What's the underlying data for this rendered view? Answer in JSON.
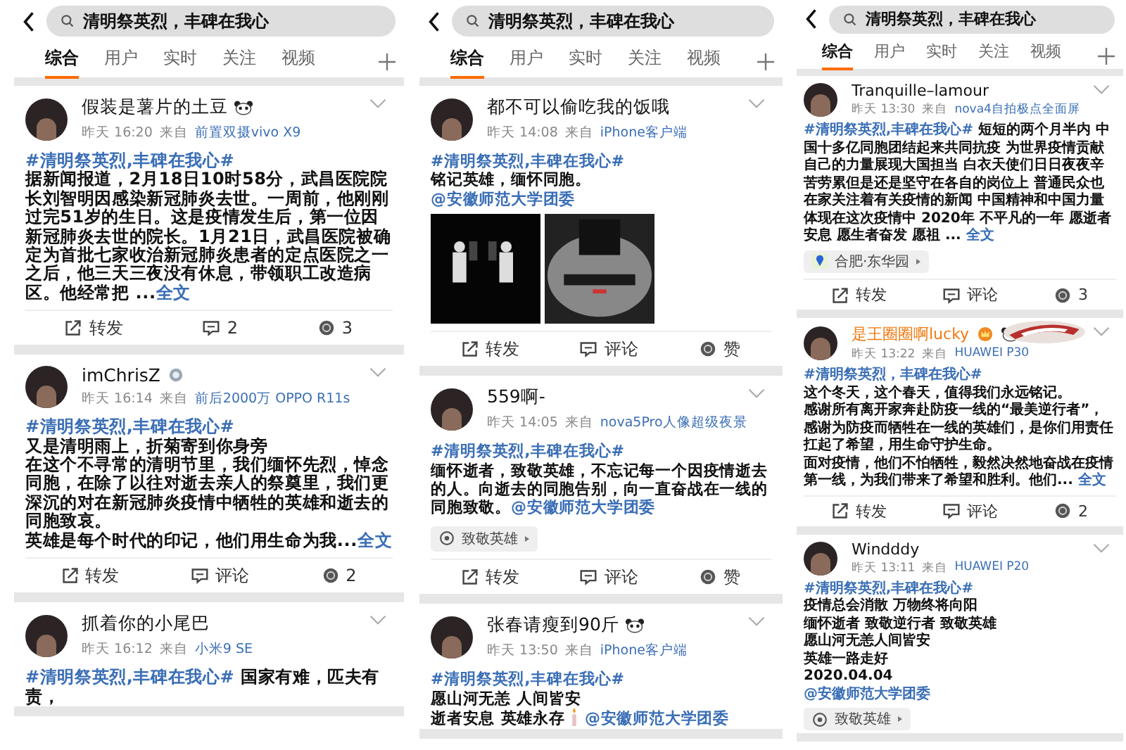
{
  "panels": [
    {
      "search": {
        "query": "清明祭英烈，丰碑在我心"
      },
      "tabs": [
        {
          "label": "综合",
          "selected": true
        },
        {
          "label": "用户",
          "selected": false
        },
        {
          "label": "实时",
          "selected": false
        },
        {
          "label": "关注",
          "selected": false
        },
        {
          "label": "视频",
          "selected": false
        }
      ],
      "posts": [
        {
          "user": "假装是薯片的土豆",
          "vip": false,
          "name_icons": [
            {
              "kind": "panda"
            }
          ],
          "time": "昨天 16:20",
          "from": "来自",
          "source": "前置双摄vivo X9",
          "body": [
            [
              {
                "kind": "tag",
                "text": "#清明祭英烈,丰碑在我心#"
              }
            ],
            [
              {
                "kind": "text",
                "text": "据新闻报道，2月18日10时58分，武昌医院院长刘智明因感染新冠肺炎去世。一周前，他刚刚过完51岁的生日。这是疫情发生后，第一位因新冠肺炎去世的院长。1月21日，武昌医院被确定为首批七家收治新冠肺炎患者的定点医院之一之后，他三天三夜没有休息，带领职工改造病区。他经常把 ..."
              },
              {
                "kind": "more",
                "text": "全文"
              }
            ]
          ],
          "actions": [
            {
              "kind": "repost",
              "label": "转发"
            },
            {
              "kind": "comment",
              "label": "2"
            },
            {
              "kind": "like",
              "label": "3"
            }
          ]
        },
        {
          "user": "imChrisZ",
          "vip": false,
          "name_icons": [
            {
              "kind": "medal"
            }
          ],
          "time": "昨天 16:14",
          "from": "来自",
          "source": "前后2000万 OPPO R11s",
          "body": [
            [
              {
                "kind": "tag",
                "text": "#清明祭英烈,丰碑在我心#"
              }
            ],
            [
              {
                "kind": "text",
                "text": "又是清明雨上，折菊寄到你身旁"
              }
            ],
            [
              {
                "kind": "text",
                "text": "在这个不寻常的清明节里，我们缅怀先烈，悼念同胞，在除了以往对逝去亲人的祭奠里，我们更深沉的对在新冠肺炎疫情中牺牲的英雄和逝去的同胞致哀。"
              }
            ],
            [
              {
                "kind": "text",
                "text": "英雄是每个时代的印记，他们用生命为我..."
              },
              {
                "kind": "more",
                "text": "全文"
              }
            ]
          ],
          "actions": [
            {
              "kind": "repost",
              "label": "转发"
            },
            {
              "kind": "comment",
              "label": "评论"
            },
            {
              "kind": "like",
              "label": "2"
            }
          ]
        },
        {
          "user": "抓着你的小尾巴",
          "vip": false,
          "time": "昨天 16:12",
          "from": "来自",
          "source": "小米9 SE",
          "body": [
            [
              {
                "kind": "tag",
                "text": "#清明祭英烈,丰碑在我心#"
              },
              {
                "kind": "text",
                "text": " 国家有难，匹夫有责，"
              }
            ]
          ]
        }
      ]
    },
    {
      "search": {
        "query": "清明祭英烈，丰碑在我心"
      },
      "tabs": [
        {
          "label": "综合",
          "selected": true
        },
        {
          "label": "用户",
          "selected": false
        },
        {
          "label": "实时",
          "selected": false
        },
        {
          "label": "关注",
          "selected": false
        },
        {
          "label": "视频",
          "selected": false
        }
      ],
      "posts": [
        {
          "user": "都不可以偷吃我的饭哦",
          "vip": false,
          "time": "昨天 14:08",
          "from": "来自",
          "source": "iPhone客户端",
          "body": [
            [
              {
                "kind": "tag",
                "text": "#清明祭英烈,丰碑在我心#"
              }
            ],
            [
              {
                "kind": "text",
                "text": "铭记英雄，缅怀同胞。"
              }
            ],
            [
              {
                "kind": "mention",
                "text": "@安徽师范大学团委"
              }
            ]
          ],
          "images": [
            {
              "kind": "picture"
            },
            {
              "kind": "picture"
            }
          ],
          "actions": [
            {
              "kind": "repost",
              "label": "转发"
            },
            {
              "kind": "comment",
              "label": "评论"
            },
            {
              "kind": "like",
              "label": "赞"
            }
          ]
        },
        {
          "user": "559啊-",
          "vip": false,
          "time": "昨天 14:05",
          "from": "来自",
          "source": "nova5Pro人像超级夜景",
          "body": [
            [
              {
                "kind": "tag",
                "text": "#清明祭英烈,丰碑在我心#"
              }
            ],
            [
              {
                "kind": "text",
                "text": "缅怀逝者，致敬英雄，不忘记每一个因疫情逝去的人。向逝去的同胞告别，向一直奋战在一线的同胞致敬。"
              },
              {
                "kind": "mention",
                "text": "@安徽师范大学团委"
              }
            ]
          ],
          "chip": {
            "kind": "topic",
            "text": "致敬英雄"
          },
          "actions": [
            {
              "kind": "repost",
              "label": "转发"
            },
            {
              "kind": "comment",
              "label": "评论"
            },
            {
              "kind": "like",
              "label": "赞"
            }
          ]
        },
        {
          "user": "张春请瘦到90斤",
          "vip": false,
          "name_icons": [
            {
              "kind": "panda"
            }
          ],
          "time": "昨天 13:50",
          "from": "来自",
          "source": "iPhone客户端",
          "body": [
            [
              {
                "kind": "tag",
                "text": "#清明祭英烈,丰碑在我心#"
              }
            ],
            [
              {
                "kind": "text",
                "text": "愿山河无恙  人间皆安"
              }
            ],
            [
              {
                "kind": "text",
                "text": "逝者安息   英雄永存"
              },
              {
                "kind": "candle"
              },
              {
                "kind": "mention",
                "text": "@安徽师范大学团委"
              }
            ]
          ]
        }
      ]
    },
    {
      "search": {
        "query": "清明祭英烈，丰碑在我心"
      },
      "tabs": [
        {
          "label": "综合",
          "selected": true
        },
        {
          "label": "用户",
          "selected": false
        },
        {
          "label": "实时",
          "selected": false
        },
        {
          "label": "关注",
          "selected": false
        },
        {
          "label": "视频",
          "selected": false
        }
      ],
      "posts": [
        {
          "user": "Tranquille–lamour",
          "vip": false,
          "time": "昨天 13:30",
          "from": "来自",
          "source": "nova4自拍极点全面屏",
          "body": [
            [
              {
                "kind": "tag",
                "text": "#清明祭英烈,丰碑在我心#"
              },
              {
                "kind": "text",
                "text": " 短短的两个月半内 中国十多亿同胞团结起来共同抗疫 为世界疫情贡献自己的力量展现大国担当 白衣天使们日日夜夜辛苦劳累但是还是坚守在各自的岗位上 普通民众也在家关注着有关疫情的新闻 中国精神和中国力量体现在这次疫情中 2020年 不平凡的一年 愿逝者安息 愿生者奋发 愿祖 ... "
              },
              {
                "kind": "more",
                "text": "全文"
              }
            ]
          ],
          "chip": {
            "kind": "location",
            "text": "合肥·东华园"
          },
          "actions": [
            {
              "kind": "repost",
              "label": "转发"
            },
            {
              "kind": "comment",
              "label": "评论"
            },
            {
              "kind": "like",
              "label": "3"
            }
          ]
        },
        {
          "user": "是王圈圈啊lucky",
          "vip": true,
          "name_icons": [
            {
              "kind": "crown"
            },
            {
              "kind": "panda"
            }
          ],
          "time": "昨天 13:22",
          "from": "来自",
          "source": "HUAWEI P30",
          "banner": {
            "kind": "picture"
          },
          "body": [
            [
              {
                "kind": "tag",
                "text": "#清明祭英烈，丰碑在我心#"
              }
            ],
            [
              {
                "kind": "text",
                "text": "这个冬天，这个春天，值得我们永远铭记。"
              }
            ],
            [
              {
                "kind": "text",
                "text": "感谢所有离开家奔赴防疫一线的“最美逆行者”，感谢为防疫而牺牲在一线的英雄们，是你们用责任扛起了希望，用生命守护生命。"
              }
            ],
            [
              {
                "kind": "text",
                "text": "面对疫情，他们不怕牺牲，毅然决然地奋战在疫情第一线，为我们带来了希望和胜利。他们... "
              },
              {
                "kind": "more",
                "text": "全文"
              }
            ]
          ],
          "actions": [
            {
              "kind": "repost",
              "label": "转发"
            },
            {
              "kind": "comment",
              "label": "评论"
            },
            {
              "kind": "like",
              "label": "2"
            }
          ]
        },
        {
          "user": "Windddy",
          "vip": false,
          "time": "昨天 13:11",
          "from": "来自",
          "source": "HUAWEI P20",
          "body": [
            [
              {
                "kind": "tag",
                "text": "#清明祭英烈,丰碑在我心#"
              }
            ],
            [
              {
                "kind": "text",
                "text": "疫情总会消散 万物终将向阳"
              }
            ],
            [
              {
                "kind": "text",
                "text": "缅怀逝者 致敬逆行者 致敬英雄"
              }
            ],
            [
              {
                "kind": "text",
                "text": "愿山河无恙人间皆安"
              }
            ],
            [
              {
                "kind": "text",
                "text": "英雄一路走好"
              }
            ],
            [
              {
                "kind": "text",
                "text": "2020.04.04"
              }
            ],
            [
              {
                "kind": "mention",
                "text": "@安徽师范大学团委"
              }
            ]
          ],
          "chip": {
            "kind": "topic",
            "text": "致敬英雄"
          }
        }
      ]
    }
  ]
}
